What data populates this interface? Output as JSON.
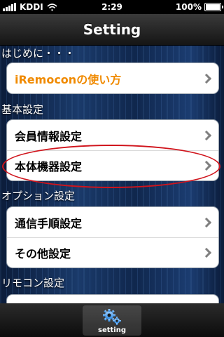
{
  "status_bar": {
    "carrier": "KDDI",
    "time": "2:29",
    "battery": "100%"
  },
  "nav": {
    "title": "Setting"
  },
  "sections": [
    {
      "header": "はじめに・・・",
      "items": [
        {
          "label": "iRemoconの使い方"
        }
      ]
    },
    {
      "header": "基本設定",
      "items": [
        {
          "label": "会員情報設定"
        },
        {
          "label": "本体機器設定"
        }
      ]
    },
    {
      "header": "オプション設定",
      "items": [
        {
          "label": "通信手順設定"
        },
        {
          "label": "その他設定"
        }
      ]
    },
    {
      "header": "リモコン設定",
      "items": []
    }
  ],
  "tab_bar": {
    "items": [
      {
        "label": "setting",
        "icon": "gears-icon"
      }
    ]
  },
  "colors": {
    "accent_orange": "#f08a00",
    "highlight_red": "#d0141c"
  }
}
